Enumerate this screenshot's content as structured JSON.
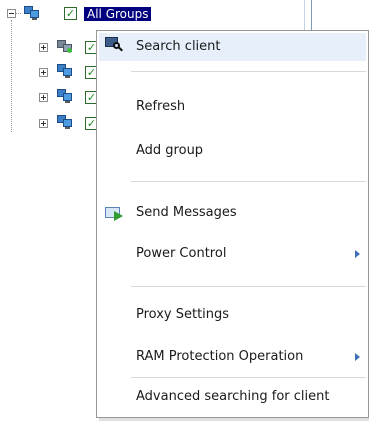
{
  "tree": {
    "root": {
      "label": "All Groups",
      "checked": true
    },
    "children": [
      {
        "checked": true,
        "icon": "client-computer-icon"
      },
      {
        "checked": true,
        "icon": "group-computers-icon"
      },
      {
        "checked": true,
        "icon": "group-computers-icon"
      },
      {
        "checked": true,
        "icon": "group-computers-icon"
      }
    ]
  },
  "context_menu": {
    "items": [
      {
        "label": "Search client",
        "icon": "search-client-icon",
        "highlighted": true
      },
      {
        "label": "Refresh"
      },
      {
        "label": "Add group"
      },
      {
        "label": "Send Messages",
        "icon": "send-message-icon"
      },
      {
        "label": "Power Control",
        "submenu": true
      },
      {
        "label": "Proxy Settings"
      },
      {
        "label": "RAM Protection Operation",
        "submenu": true
      },
      {
        "label": "Advanced searching for client"
      }
    ]
  },
  "colors": {
    "selection_bg": "#00007f",
    "menu_hover": "#e7f0fa",
    "submenu_arrow": "#3c6fb4",
    "checkbox_green": "#1d8a1d"
  }
}
